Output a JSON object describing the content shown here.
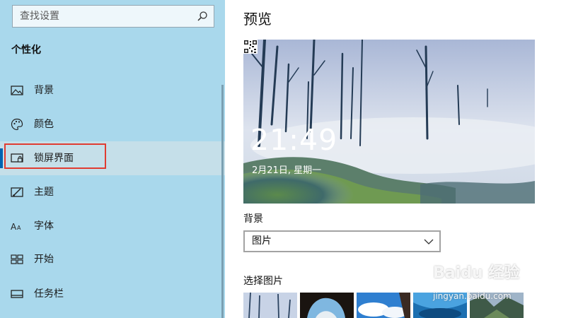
{
  "sidebar": {
    "search": {
      "placeholder": "查找设置",
      "icon": "search-icon"
    },
    "section_title": "个性化",
    "items": [
      {
        "label": "背景",
        "icon": "picture-icon"
      },
      {
        "label": "颜色",
        "icon": "palette-icon"
      },
      {
        "label": "锁屏界面",
        "icon": "lock-screen-icon",
        "selected": true
      },
      {
        "label": "主题",
        "icon": "theme-icon"
      },
      {
        "label": "字体",
        "icon": "font-icon"
      },
      {
        "label": "开始",
        "icon": "start-icon"
      },
      {
        "label": "任务栏",
        "icon": "taskbar-icon"
      }
    ]
  },
  "main": {
    "title": "预览",
    "preview": {
      "time": "21:49",
      "date": "2月21日, 星期一"
    },
    "background_label": "背景",
    "background_select": {
      "value": "图片"
    },
    "choose_picture_label": "选择图片",
    "thumbnails": [
      "snowy-trees",
      "cave-arch",
      "sky-clouds",
      "ice-cave",
      "mountain-valley"
    ]
  },
  "watermark": {
    "logo": "Baidu 经验",
    "url": "jingyan.baidu.com"
  },
  "colors": {
    "sidebar_bg": "#a9d8ec",
    "selected_item_bg": "#c5dfe9",
    "accent": "#0063b1",
    "annotation_red": "#e03c31"
  }
}
